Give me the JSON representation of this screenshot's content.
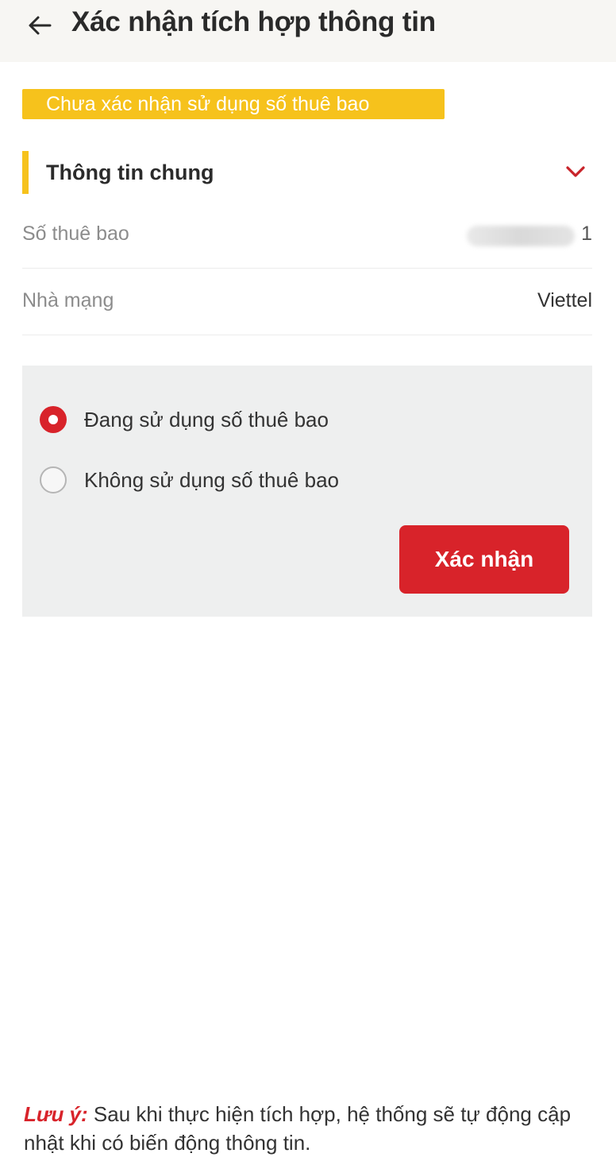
{
  "header": {
    "title": "Xác nhận tích hợp thông tin",
    "back_icon": "arrow-left-icon"
  },
  "status_badge": {
    "text": "Chưa xác nhận sử dụng số thuê bao",
    "color": "#f6c21c"
  },
  "section": {
    "title": "Thông tin chung",
    "chevron_icon": "chevron-down-icon",
    "accent": "#f6c21c"
  },
  "info": {
    "phone_label": "Số thuê bao",
    "phone_visible_tail": "1",
    "carrier_label": "Nhà mạng",
    "carrier_value": "Viettel"
  },
  "options": [
    {
      "label": "Đang sử dụng số thuê bao",
      "selected": true
    },
    {
      "label": "Không sử dụng số thuê bao",
      "selected": false
    }
  ],
  "confirm_button": {
    "label": "Xác nhận",
    "color": "#d8232a"
  },
  "note": {
    "label": "Lưu ý:",
    "text": " Sau khi thực hiện tích hợp, hệ thống sẽ tự động cập nhật khi có biến động thông tin."
  }
}
